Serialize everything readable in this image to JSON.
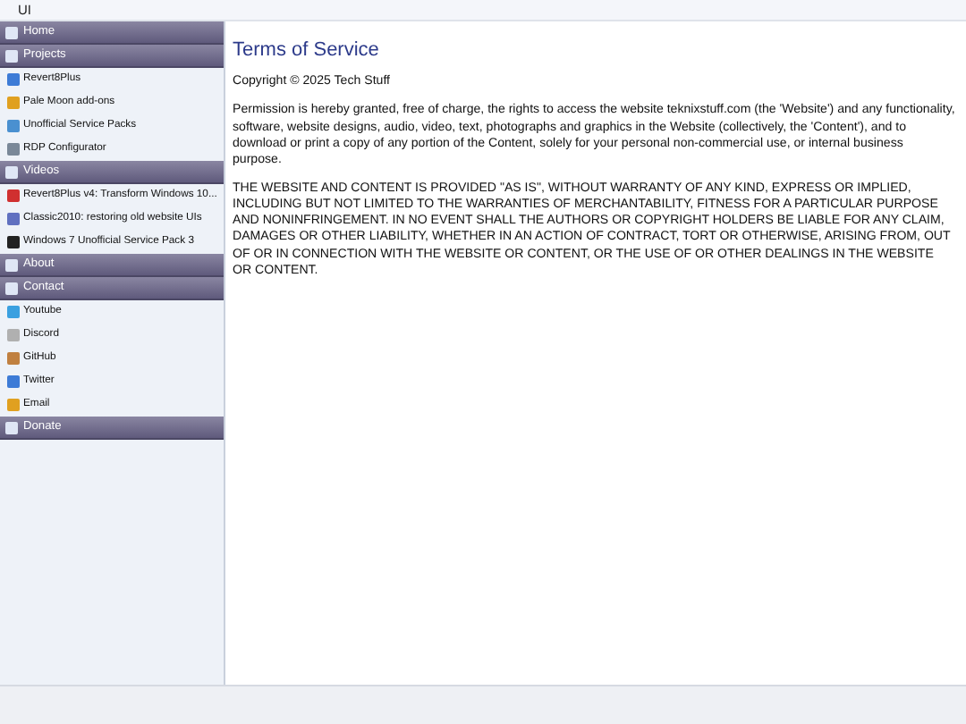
{
  "window": {
    "title": "UI"
  },
  "sidebar": {
    "sections": [
      {
        "title": "Home"
      },
      {
        "title": "Projects",
        "items": [
          "Revert8Plus",
          "Pale Moon add-ons",
          "Unofficial Service Packs",
          "RDP Configurator"
        ]
      },
      {
        "title": "Videos",
        "items": [
          "Revert8Plus v4: Transform Windows 10...",
          "Classic2010: restoring old website UIs",
          "Windows 7 Unofficial Service Pack 3"
        ]
      },
      {
        "title": "About"
      },
      {
        "title": "Contact",
        "items": [
          "Youtube",
          "Discord",
          "GitHub",
          "Twitter",
          "Email"
        ]
      },
      {
        "title": "Donate"
      }
    ]
  },
  "content": {
    "title": "Terms of Service",
    "paragraphs": [
      "Copyright © 2025 Tech Stuff",
      "Permission is hereby granted, free of charge, the rights to access the website teknixstuff.com (the 'Website') and any functionality, software, website designs, audio, video, text, photographs and graphics in the Website (collectively, the 'Content'), and to download or print a copy of any portion of the Content, solely for your personal non-commercial use, or internal business purpose.",
      "THE WEBSITE AND CONTENT IS PROVIDED \"AS IS\", WITHOUT WARRANTY OF ANY KIND, EXPRESS OR IMPLIED, INCLUDING BUT NOT LIMITED TO THE WARRANTIES OF MERCHANTABILITY, FITNESS FOR A PARTICULAR PURPOSE AND NONINFRINGEMENT. IN NO EVENT SHALL THE AUTHORS OR COPYRIGHT HOLDERS BE LIABLE FOR ANY CLAIM, DAMAGES OR OTHER LIABILITY, WHETHER IN AN ACTION OF CONTRACT, TORT OR OTHERWISE, ARISING FROM, OUT OF OR IN CONNECTION WITH THE WEBSITE OR CONTENT, OR THE USE OF OR OTHER DEALINGS IN THE WEBSITE OR CONTENT."
    ]
  }
}
